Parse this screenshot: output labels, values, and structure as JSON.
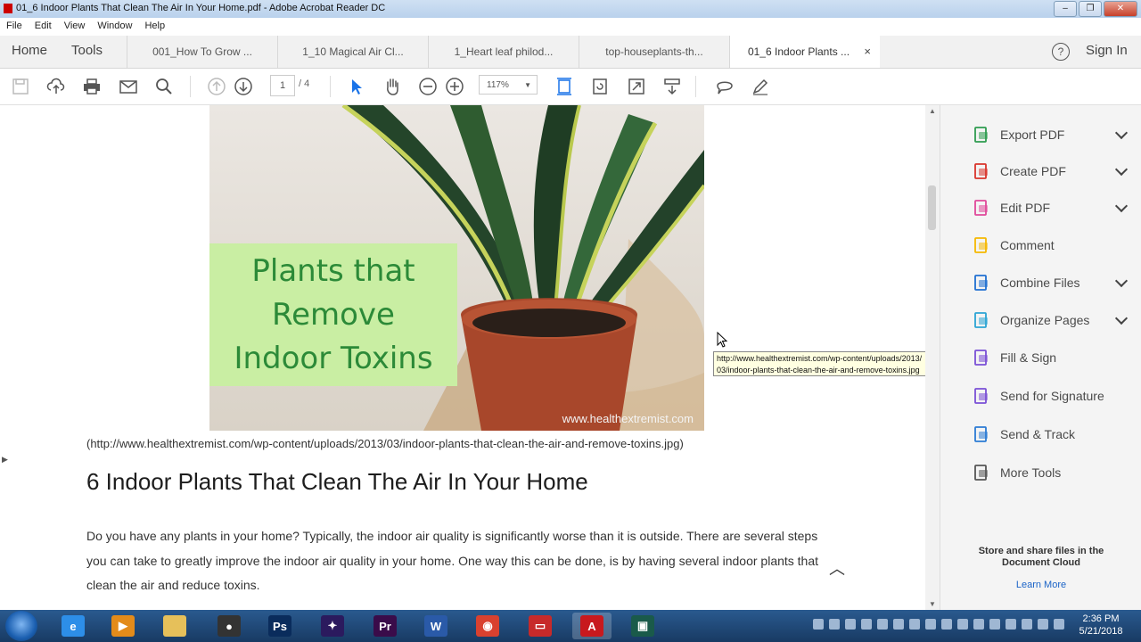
{
  "window": {
    "title": "01_6 Indoor Plants That Clean The Air In Your Home.pdf - Adobe Acrobat Reader DC",
    "buttons": [
      "–",
      "❐",
      "✕"
    ]
  },
  "menu": [
    "File",
    "Edit",
    "View",
    "Window",
    "Help"
  ],
  "tabs": {
    "home": "Home",
    "tools": "Tools",
    "documents": [
      {
        "label": "001_How To Grow ..."
      },
      {
        "label": "1_10 Magical Air Cl..."
      },
      {
        "label": "1_Heart leaf philod..."
      },
      {
        "label": "top-houseplants-th..."
      },
      {
        "label": "01_6 Indoor Plants ...",
        "active": true,
        "close": "×"
      }
    ],
    "help_icon": "?",
    "sign_in": "Sign In"
  },
  "toolbar": {
    "page_current": "1",
    "page_total": "/ 4",
    "zoom": "117%",
    "icons": [
      "save-icon",
      "cloud-upload-icon",
      "print-icon",
      "email-icon",
      "search-icon",
      "page-up-icon",
      "page-down-icon",
      "select-arrow-icon",
      "hand-icon",
      "zoom-out-icon",
      "zoom-in-icon",
      "fit-page-icon",
      "rotate-icon",
      "fullscreen-icon",
      "scroll-mode-icon",
      "comment-icon",
      "pen-icon"
    ]
  },
  "document": {
    "image_overlay_text": "Plants that\nRemove\nIndoor Toxins",
    "image_watermark": "www.healthextremist.com",
    "tooltip": "http://www.healthextremist.com/wp-content/uploads/2013/\n03/indoor-plants-that-clean-the-air-and-remove-toxins.jpg",
    "caption": "(http://www.healthextremist.com/wp-content/uploads/2013/03/indoor-plants-that-clean-the-air-and-remove-toxins.jpg)",
    "heading": "6 Indoor Plants That Clean The Air In Your Home",
    "paragraph": "Do you have any plants in your home? Typically, the indoor air quality is significantly worse than it is outside.  There are several steps you can take to greatly improve the indoor air quality in your home. One way this can be done, is by having several indoor plants that clean the air and reduce toxins."
  },
  "right_panel": {
    "items": [
      {
        "label": "Export PDF",
        "icon": "export-pdf-icon",
        "color": "#2e9c4f",
        "expand": true
      },
      {
        "label": "Create PDF",
        "icon": "create-pdf-icon",
        "color": "#d9342b",
        "expand": true
      },
      {
        "label": "Edit PDF",
        "icon": "edit-pdf-icon",
        "color": "#e0489a",
        "expand": true
      },
      {
        "label": "Comment",
        "icon": "comment-bubble-icon",
        "color": "#f5b800",
        "expand": false
      },
      {
        "label": "Combine Files",
        "icon": "combine-files-icon",
        "color": "#1f6fd1",
        "expand": true
      },
      {
        "label": "Organize Pages",
        "icon": "organize-pages-icon",
        "color": "#2ba4d4",
        "expand": true
      },
      {
        "label": "Fill & Sign",
        "icon": "fill-sign-icon",
        "color": "#7a4fd6",
        "expand": false
      },
      {
        "label": "Send for Signature",
        "icon": "send-signature-icon",
        "color": "#7a4fd6",
        "expand": false
      },
      {
        "label": "Send & Track",
        "icon": "send-track-icon",
        "color": "#2b7bd4",
        "expand": false
      },
      {
        "label": "More Tools",
        "icon": "more-tools-icon",
        "color": "#555555",
        "expand": false
      }
    ],
    "promo": "Store and share files in the\nDocument Cloud",
    "learn_more": "Learn More"
  },
  "taskbar": {
    "apps": [
      {
        "name": "internet-explorer",
        "glyph": "e",
        "color": "#2d8ee8"
      },
      {
        "name": "media-player",
        "glyph": "▶",
        "color": "#e38b1a"
      },
      {
        "name": "file-explorer",
        "glyph": "",
        "color": "#e6c05a"
      },
      {
        "name": "obs",
        "glyph": "●",
        "color": "#333333"
      },
      {
        "name": "photoshop",
        "glyph": "Ps",
        "color": "#0a2c5c"
      },
      {
        "name": "after-effects",
        "glyph": "✦",
        "color": "#2b1a5e"
      },
      {
        "name": "premiere",
        "glyph": "Pr",
        "color": "#3a0c4a"
      },
      {
        "name": "word",
        "glyph": "W",
        "color": "#2a5aa8"
      },
      {
        "name": "chrome",
        "glyph": "◉",
        "color": "#d9412f"
      },
      {
        "name": "tv-app",
        "glyph": "▭",
        "color": "#c72a2a"
      },
      {
        "name": "acrobat",
        "glyph": "A",
        "color": "#c8191e"
      },
      {
        "name": "camtasia",
        "glyph": "▣",
        "color": "#1a5a4a"
      }
    ],
    "clock_time": "2:36 PM",
    "clock_date": "5/21/2018"
  }
}
